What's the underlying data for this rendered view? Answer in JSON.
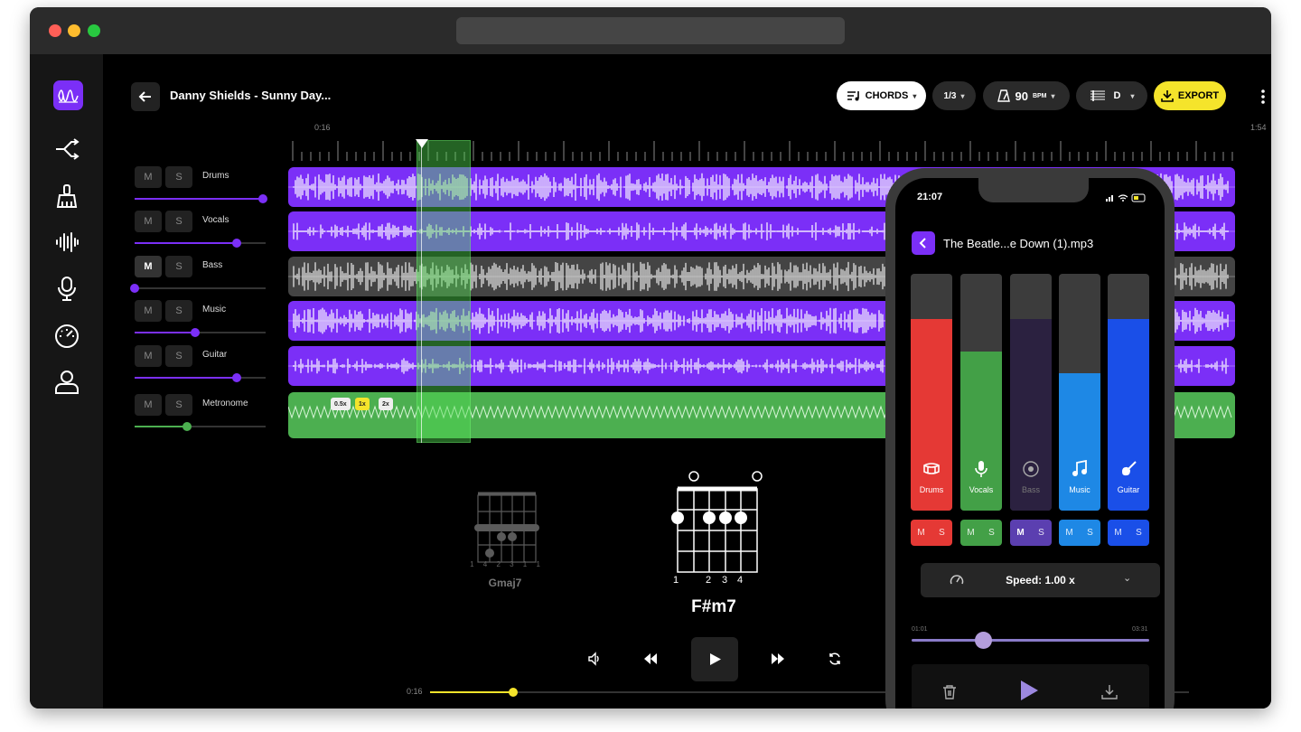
{
  "header": {
    "song_title": "Danny Shields - Sunny Day...",
    "chords_label": "CHORDS",
    "time_sig_label": "1/3",
    "tempo_value": "90",
    "tempo_unit": "BPM",
    "key_value": "D",
    "export_label": "EXPORT"
  },
  "timeline": {
    "start_time": "0:16",
    "end_time": "1:54"
  },
  "tracks": [
    {
      "name": "Drums",
      "mute": "M",
      "solo": "S",
      "volume": 0.98,
      "color": "#7b2ff7"
    },
    {
      "name": "Vocals",
      "mute": "M",
      "solo": "S",
      "volume": 0.78,
      "color": "#7b2ff7"
    },
    {
      "name": "Bass",
      "mute": "M",
      "solo": "S",
      "volume": 0.0,
      "color": "#444444"
    },
    {
      "name": "Music",
      "mute": "M",
      "solo": "S",
      "volume": 0.46,
      "color": "#7b2ff7"
    },
    {
      "name": "Guitar",
      "mute": "M",
      "solo": "S",
      "volume": 0.78,
      "color": "#7b2ff7"
    },
    {
      "name": "Metronome",
      "mute": "M",
      "solo": "S",
      "volume": 0.4,
      "color": "#4caf50"
    }
  ],
  "metronome_speeds": [
    "0.5x",
    "1x",
    "2x"
  ],
  "chords": {
    "previous": {
      "name": "Gmaj7",
      "fingering": "1 4 2 3 1 1"
    },
    "current": {
      "name": "F#m7",
      "fingers": [
        "1",
        "2",
        "3",
        "4"
      ]
    }
  },
  "transport": {
    "current_time": "0:16",
    "progress": 0.11
  },
  "phone": {
    "status_time": "21:07",
    "file_title": "The Beatle...e Down (1).mp3",
    "mixer": [
      {
        "name": "Drums",
        "level": 0.81,
        "color": "#e53935",
        "icon": "drum-icon"
      },
      {
        "name": "Vocals",
        "level": 0.67,
        "color": "#43a047",
        "icon": "microphone-icon"
      },
      {
        "name": "Bass",
        "level": 0.81,
        "color": "#2b2140",
        "icon": "bass-icon"
      },
      {
        "name": "Music",
        "level": 0.58,
        "color": "#1e88e5",
        "icon": "music-note-icon"
      },
      {
        "name": "Guitar",
        "level": 0.81,
        "color": "#1a4fe8",
        "icon": "guitar-icon"
      }
    ],
    "mute": "M",
    "solo": "S",
    "speed_label": "Speed: 1.00 x",
    "elapsed": "01:01",
    "duration": "03:31",
    "progress": 0.3
  }
}
